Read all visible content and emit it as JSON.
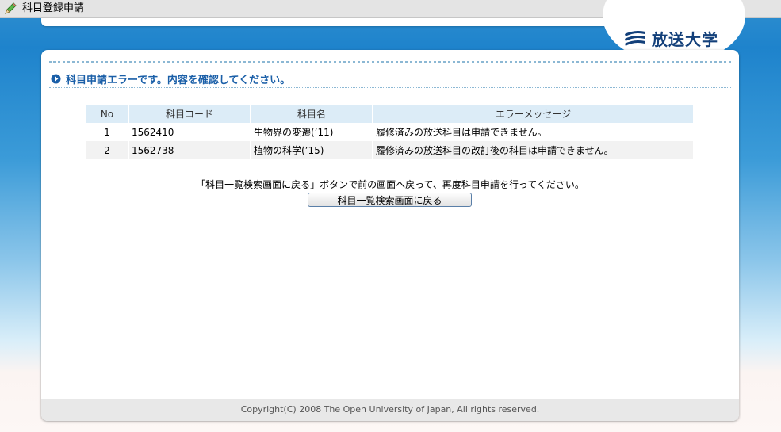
{
  "window": {
    "title": "科目登録申請",
    "icon": "pencil-icon"
  },
  "brand": {
    "logo_text": "放送大学",
    "logo_color": "#13407a"
  },
  "message": {
    "heading": "科目申請エラーです。内容を確認してください。",
    "heading_color": "#1a5fa8"
  },
  "table": {
    "headers": {
      "no": "No",
      "code": "科目コード",
      "name": "科目名",
      "error": "エラーメッセージ"
    },
    "rows": [
      {
        "no": "1",
        "code": "1562410",
        "name": "生物界の変遷(’11)",
        "error": "履修済みの放送科目は申請できません。"
      },
      {
        "no": "2",
        "code": "1562738",
        "name": "植物の科学(’15)",
        "error": "履修済みの放送科目の改訂後の科目は申請できません。"
      }
    ]
  },
  "instruction": {
    "text": "「科目一覧検索画面に戻る」ボタンで前の画面へ戻って、再度科目申請を行ってください。",
    "button_label": "科目一覧検索画面に戻る"
  },
  "footer": {
    "copyright": "Copyright(C) 2008 The Open University of Japan, All rights reserved."
  }
}
